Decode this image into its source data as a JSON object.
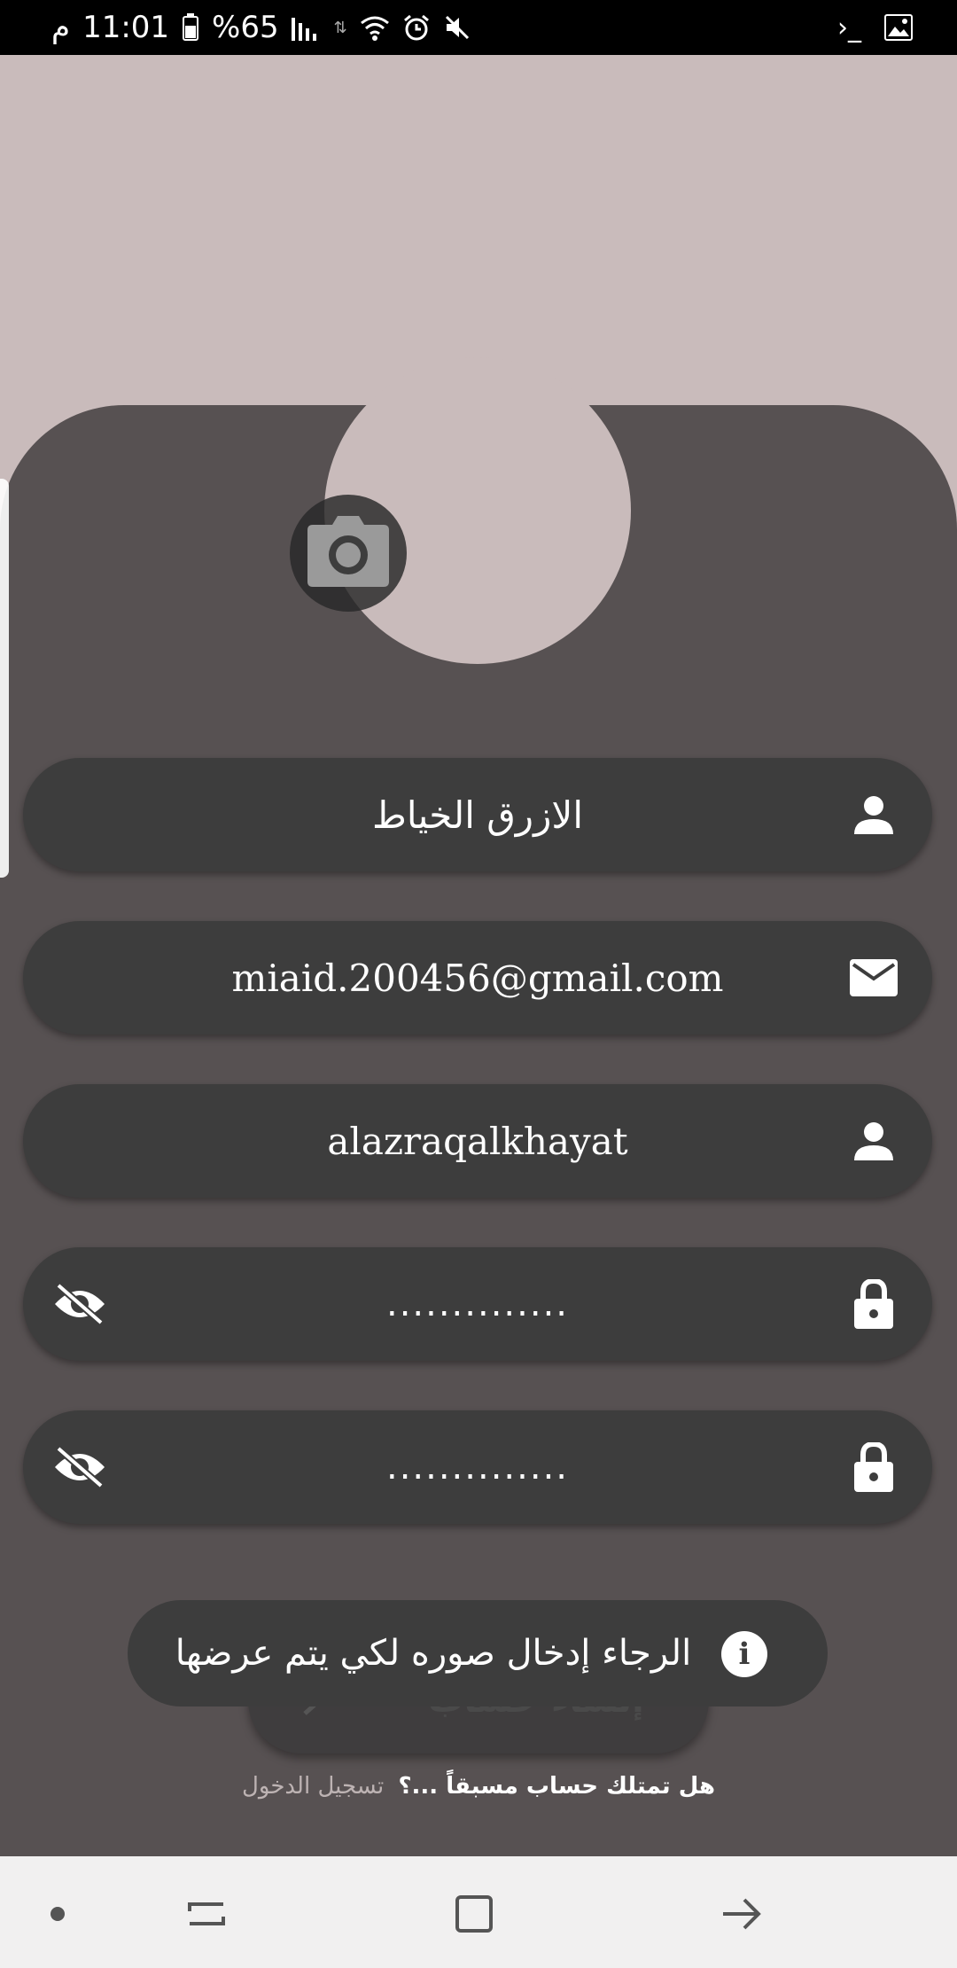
{
  "status_bar": {
    "time": "11:01",
    "period": "م",
    "battery": "%65",
    "icons": [
      "battery-icon",
      "signal-icon",
      "wifi-icon",
      "alarm-icon",
      "mute-icon",
      "terminal-icon",
      "gallery-icon"
    ]
  },
  "form": {
    "name_value": "الازرق الخياط",
    "email_value": "miaid.200456@gmail.com",
    "username_value": "alazraqalkhayat",
    "password_value": "..............",
    "confirm_password_value": ".............."
  },
  "create_button": {
    "label": "إنشاء حساب"
  },
  "toast": {
    "message": "الرجاء إدخال صوره لكي يتم عرضها"
  },
  "login_prompt": {
    "question": "هل تمتلك حساب مسبقاً ...؟",
    "link": "تسجيل الدخول"
  },
  "colors": {
    "background": "#c9bbbb",
    "card": "#575152",
    "field": "#3d3d3d",
    "nav": "#f1f0f0"
  }
}
